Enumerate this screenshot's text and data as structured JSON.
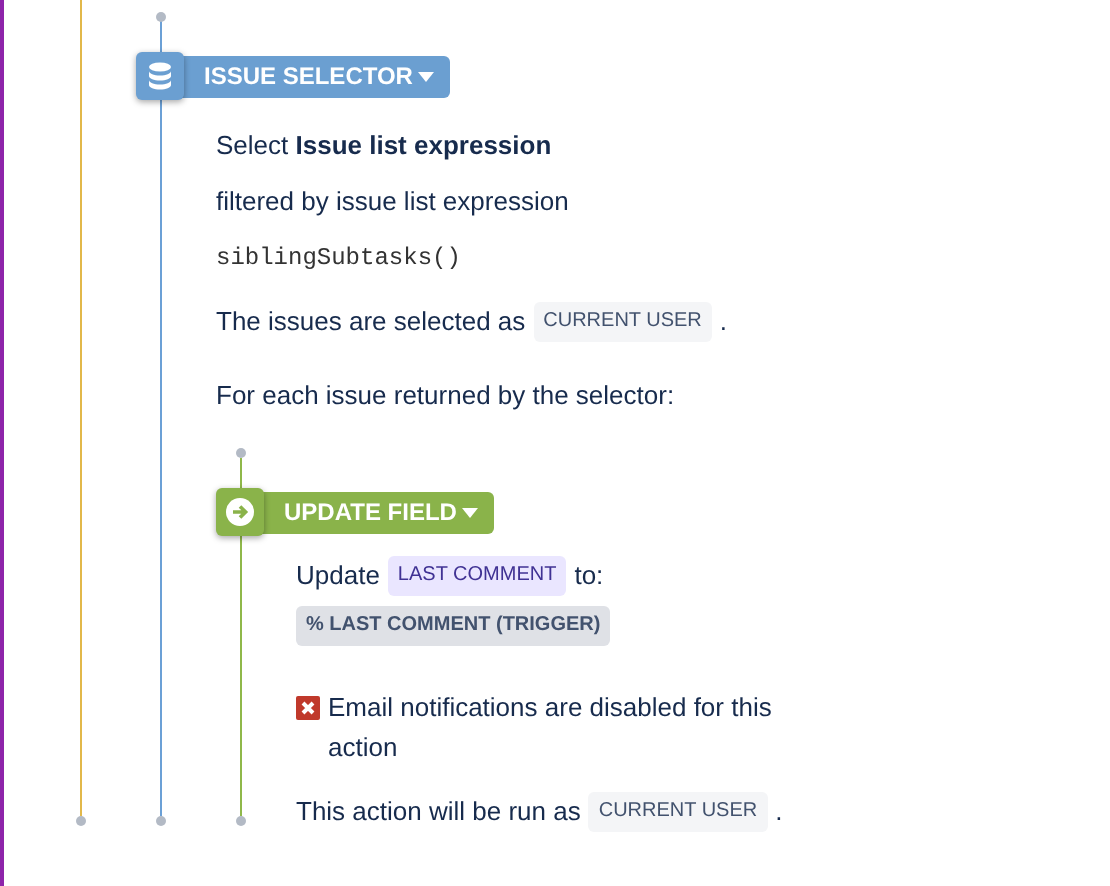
{
  "selector": {
    "title": "ISSUE SELECTOR",
    "intro": "Select **Issue list expression**",
    "filter_text": "filtered by issue list expression",
    "expression": "siblingSubtasks()",
    "run_as_prefix": "The issues are selected as",
    "run_as_user": "CURRENT USER",
    "run_as_suffix": ".",
    "loop_text": "For each issue returned by the selector:"
  },
  "action": {
    "title": "UPDATE FIELD",
    "update_prefix": "Update",
    "field": "LAST COMMENT",
    "update_suffix": "to:",
    "value": "% LAST COMMENT (TRIGGER)",
    "email_notifications": false,
    "email_text": "Email notifications are disabled for this action",
    "run_as_prefix": "This action will be run as",
    "run_as_user": "CURRENT USER",
    "run_as_suffix": "."
  }
}
